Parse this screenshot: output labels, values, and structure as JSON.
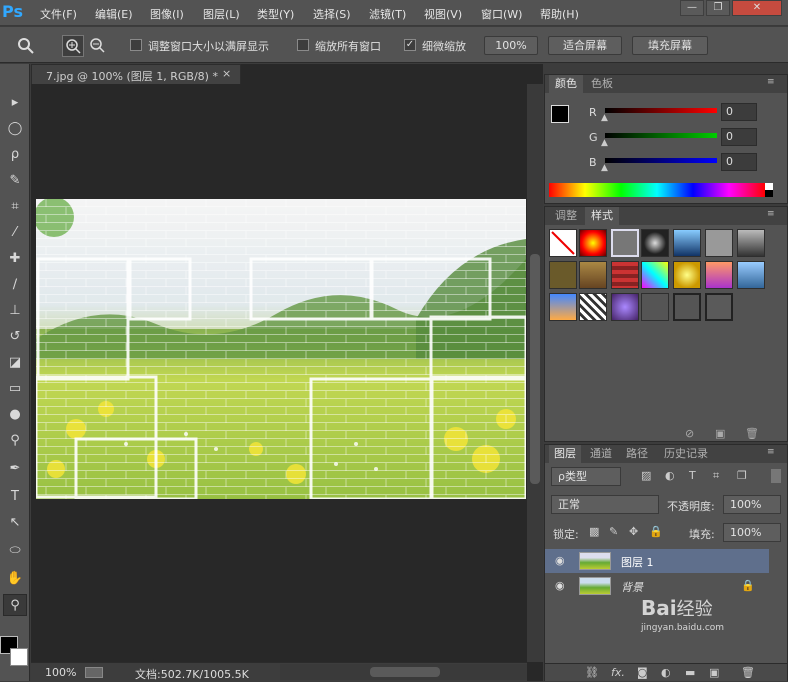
{
  "app": {
    "logo": "Ps"
  },
  "menu": [
    "文件(F)",
    "编辑(E)",
    "图像(I)",
    "图层(L)",
    "类型(Y)",
    "选择(S)",
    "滤镜(T)",
    "视图(V)",
    "窗口(W)",
    "帮助(H)"
  ],
  "window_buttons": {
    "minimize": "—",
    "restore": "❐",
    "close": "✕"
  },
  "options": {
    "resize_windows_label": "调整窗口大小以满屏显示",
    "zoom_all_label": "缩放所有窗口",
    "scrubby_label": "细微缩放",
    "scrubby_check": "✓",
    "zoom_value": "100%",
    "fit_screen": "适合屏幕",
    "fill_screen": "填充屏幕"
  },
  "document": {
    "tab_title": "7.jpg @ 100% (图层 1, RGB/8) *",
    "close": "×"
  },
  "status": {
    "zoom": "100%",
    "doc_size": "文档:502.7K/1005.5K"
  },
  "color_panel": {
    "tabs": [
      "颜色",
      "色板"
    ],
    "r_label": "R",
    "g_label": "G",
    "b_label": "B",
    "r_value": "0",
    "g_value": "0",
    "b_value": "0",
    "colors": {
      "r": "#ff0000",
      "g": "#00cc00",
      "b": "#0000ff"
    }
  },
  "styles_panel": {
    "tabs": [
      "调整",
      "样式"
    ]
  },
  "layers_panel": {
    "tabs": [
      "图层",
      "通道",
      "路径",
      "历史记录"
    ],
    "filter_kind": "ρ类型",
    "blend_mode": "正常",
    "opacity_label": "不透明度:",
    "opacity_value": "100%",
    "lock_label": "锁定:",
    "fill_label": "填充:",
    "fill_value": "100%",
    "layers": [
      {
        "name": "图层 1",
        "selected": true
      },
      {
        "name": "背景",
        "selected": false
      }
    ],
    "footer_fx": "fx."
  },
  "watermark": {
    "text": "Bai",
    "text2": "经验",
    "url": "jingyan.baidu.com"
  }
}
